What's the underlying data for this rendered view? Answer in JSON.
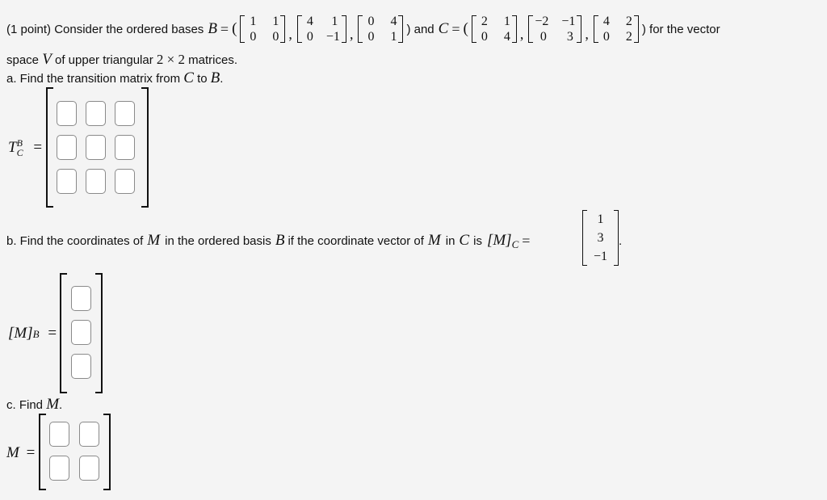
{
  "question": {
    "points": "(1 point) Consider the ordered bases",
    "basis_B_name": "B",
    "basis_C_name": "C",
    "basis_B": [
      [
        [
          "1",
          "1"
        ],
        [
          "0",
          "0"
        ]
      ],
      [
        [
          "4",
          "1"
        ],
        [
          "0",
          "−1"
        ]
      ],
      [
        [
          "0",
          "4"
        ],
        [
          "0",
          "1"
        ]
      ]
    ],
    "basis_C": [
      [
        [
          "2",
          "1"
        ],
        [
          "0",
          "4"
        ]
      ],
      [
        [
          "−2",
          "−1"
        ],
        [
          "0",
          "3"
        ]
      ],
      [
        [
          "4",
          "2"
        ],
        [
          "0",
          "2"
        ]
      ]
    ],
    "and_text": ") and",
    "for_text": ") for the vector",
    "line2_pre": "space",
    "line2_var": "V",
    "line2_post": "of upper triangular",
    "line2_dims": "2 × 2",
    "line2_end": "matrices."
  },
  "part_a": {
    "prompt_pre": "a. Find the transition matrix from",
    "from": "C",
    "to_text": "to",
    "to": "B",
    "period": ".",
    "label_T": "T",
    "label_sup": "B",
    "label_sub": "C",
    "equals": "=",
    "rows": 3,
    "cols": 3
  },
  "part_b": {
    "prompt_1": "b. Find the coordinates of",
    "var_M": "M",
    "prompt_2": "in the ordered basis",
    "var_B": "B",
    "prompt_3": "if the coordinate vector of",
    "prompt_4": "in",
    "var_C": "C",
    "prompt_5": "is",
    "coord_label": "[M]",
    "coord_sub": "C",
    "equals": "=",
    "coord_vector": [
      "1",
      "3",
      "−1"
    ],
    "period": ".",
    "answer_label": "[M]",
    "answer_sub": "B",
    "rows": 3
  },
  "part_c": {
    "prompt": "c. Find",
    "var": "M",
    "period": ".",
    "label": "M",
    "equals": "=",
    "rows": 2,
    "cols": 2
  }
}
